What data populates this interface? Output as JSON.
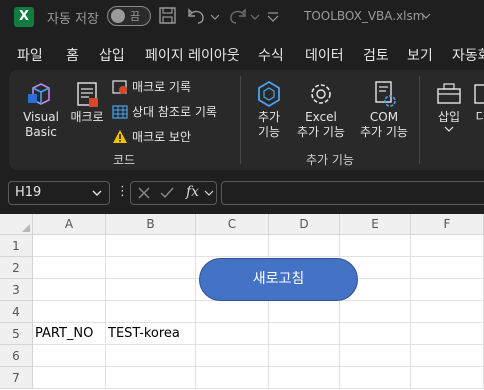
{
  "titlebar": {
    "app_logo": "X",
    "autosave_label": "자동 저장",
    "toggle_text": "끔",
    "filename": "TOOLBOX_VBA.xlsm"
  },
  "menu": [
    "파일",
    "홈",
    "삽입",
    "페이지 레이아웃",
    "수식",
    "데이터",
    "검토",
    "보기",
    "자동화"
  ],
  "ribbon": {
    "visual_basic": "Visual\nBasic",
    "visual_basic_l1": "Visual",
    "visual_basic_l2": "Basic",
    "macro": "매크로",
    "record_macro": "매크로 기록",
    "relative_ref": "상대 참조로 기록",
    "macro_security": "매크로 보안",
    "group_code": "코드",
    "addins_l1": "추가",
    "addins_l2": "기능",
    "excel_addins_l1": "Excel",
    "excel_addins_l2": "추가 기능",
    "com_addins_l1": "COM",
    "com_addins_l2": "추가 기능",
    "group_addins": "추가 기능",
    "insert_label": "삽입",
    "design_label": "디"
  },
  "formula_bar": {
    "name_box": "H19",
    "formula": ""
  },
  "grid": {
    "columns": [
      "A",
      "B",
      "C",
      "D",
      "E",
      "F"
    ],
    "rows": [
      "1",
      "2",
      "3",
      "4",
      "5",
      "6",
      "7"
    ],
    "cells": {
      "A5": "PART_NO",
      "B5": "TEST-korea"
    },
    "refresh_button": "새로고침"
  },
  "colors": {
    "excel_green": "#107c41",
    "button_fill": "#4472c4",
    "ribbon_bg": "#292929",
    "window_bg": "#1f1f1f",
    "addin_icon": "#4aa3f0",
    "warning": "#f2c200"
  }
}
